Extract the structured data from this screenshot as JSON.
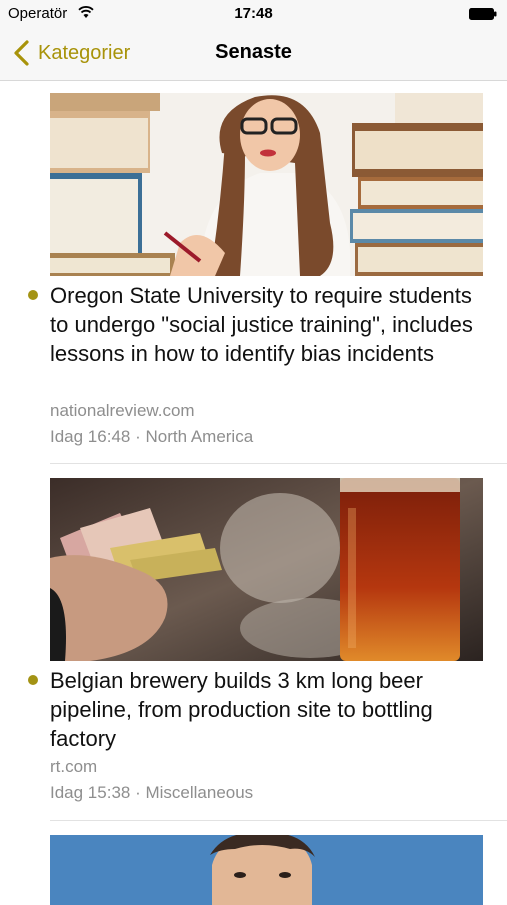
{
  "status_bar": {
    "carrier": "Operatör",
    "time": "17:48"
  },
  "nav": {
    "back_label": "Kategorier",
    "title": "Senaste"
  },
  "colors": {
    "accent": "#a8930a",
    "bullet": "#a39314",
    "muted": "#8e8e8e"
  },
  "articles": [
    {
      "headline": "Oregon State University to require students to undergo \"social justice training\", includes lessons in how to identify bias incidents",
      "source": "nationalreview.com",
      "meta": "Idag 16:48 · North America",
      "image": "woman-with-books-photo"
    },
    {
      "headline": "Belgian brewery builds 3 km long beer pipeline, from production site to bottling factory",
      "source": "rt.com",
      "meta": "Idag 15:38 · Miscellaneous",
      "image": "cash-and-beer-photo"
    },
    {
      "image": "man-portrait-photo"
    }
  ]
}
